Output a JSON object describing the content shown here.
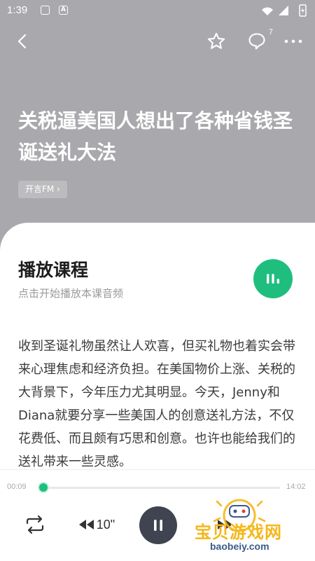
{
  "status_bar": {
    "time": "1:39"
  },
  "header": {
    "comment_count": "7"
  },
  "episode": {
    "title": "关税逼美国人想出了各种省钱圣诞送礼大法",
    "tag": "开言FM ›"
  },
  "course": {
    "heading": "播放课程",
    "subtitle": "点击开始播放本课音频",
    "description": "收到圣诞礼物虽然让人欢喜，但买礼物也着实会带来心理焦虑和经济负担。在美国物价上涨、关税的大背景下，今年压力尤其明显。今天，Jenny和Diana就要分享一些美国人的创意送礼方法，不仅花费低、而且颇有巧思和创意。也许也能给我们的送礼带来一些灵感。"
  },
  "player": {
    "elapsed": "00:09",
    "duration": "14:02",
    "progress": 0.011,
    "rewind_label": "10\""
  },
  "watermark": {
    "text": "宝贝游戏网",
    "url": "baobeiy.com"
  },
  "colors": {
    "accent": "#1fbe7e",
    "header_bg": "#a9a9ad",
    "pause_bg": "#3f4450"
  }
}
